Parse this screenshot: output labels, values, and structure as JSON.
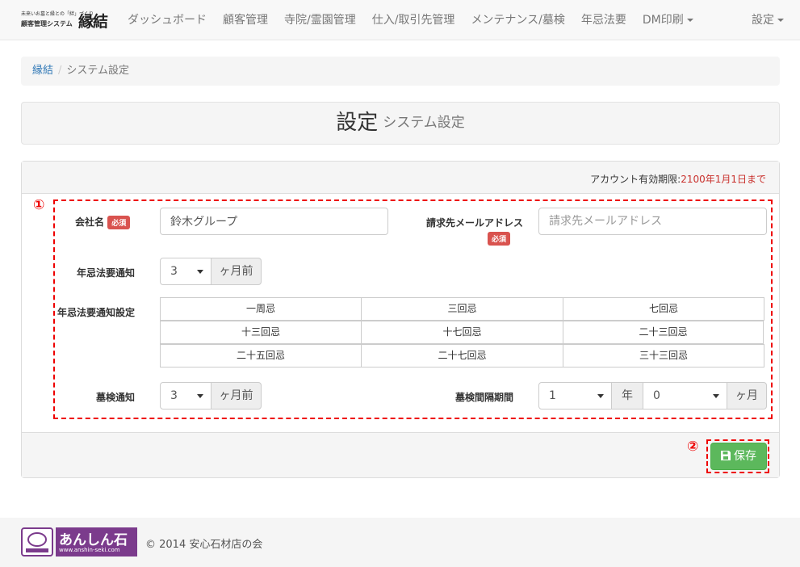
{
  "brand": {
    "tagline": "未来いお墓と縁との「絆」づくり",
    "subtitle": "顧客管理システム",
    "name": "縁結"
  },
  "nav": {
    "items": [
      {
        "label": "ダッシュボード"
      },
      {
        "label": "顧客管理"
      },
      {
        "label": "寺院/霊園管理"
      },
      {
        "label": "仕入/取引先管理"
      },
      {
        "label": "メンテナンス/墓検"
      },
      {
        "label": "年忌法要"
      },
      {
        "label": "DM印刷"
      }
    ],
    "settings": "設定"
  },
  "breadcrumb": {
    "home": "縁結",
    "separator": "/",
    "current": "システム設定"
  },
  "page": {
    "title": "設定",
    "subtitle": "システム設定"
  },
  "panel": {
    "account_label": "アカウント有効期限:",
    "account_value": "2100年1月1日まで"
  },
  "markers": {
    "one": "①",
    "two": "②"
  },
  "form": {
    "company_label": "会社名",
    "required": "必須",
    "company_value": "鈴木グループ",
    "email_label": "請求先メールアドレス",
    "email_placeholder": "請求先メールアドレス",
    "memorial_notice_label": "年忌法要通知",
    "memorial_notice_value": "3",
    "months_before": "ヶ月前",
    "memorial_setting_label": "年忌法要通知設定",
    "memorial_options": [
      "一周忌",
      "三回忌",
      "七回忌",
      "十三回忌",
      "十七回忌",
      "二十三回忌",
      "二十五回忌",
      "二十七回忌",
      "三十三回忌"
    ],
    "inspection_notice_label": "墓検通知",
    "inspection_notice_value": "3",
    "inspection_interval_label": "墓検間隔期間",
    "interval_years_value": "1",
    "year_unit": "年",
    "interval_months_value": "0",
    "month_unit": "ヶ月"
  },
  "save_button": "保存",
  "footer": {
    "logo_text": "あんしん石",
    "logo_url": "www.anshin-seki.com",
    "copyright": "© 2014 安心石材店の会"
  },
  "colors": {
    "required": "#d9534f",
    "save": "#5cb85c",
    "marker": "#ee0000",
    "logo": "#7b3b8c"
  }
}
